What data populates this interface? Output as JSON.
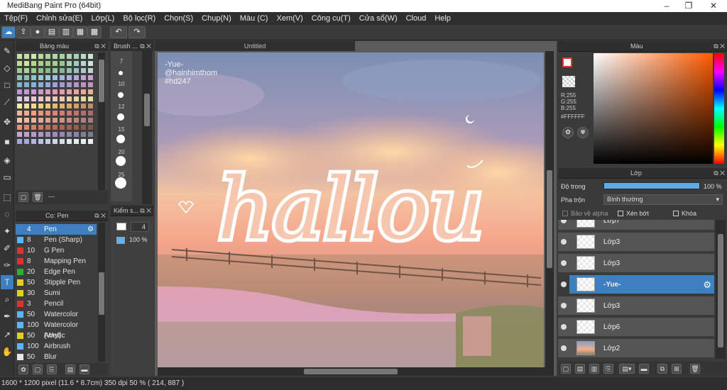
{
  "window": {
    "title": "MediBang Paint Pro (64bit)",
    "min": "–",
    "max": "❐",
    "close": "✕"
  },
  "menu": [
    "Tệp(F)",
    "Chỉnh sửa(E)",
    "Lớp(L)",
    "Bộ lọc(R)",
    "Chọn(S)",
    "Chụp(N)",
    "Màu (C)",
    "Xem(V)",
    "Công cụ(T)",
    "Cửa sổ(W)",
    "Cloud",
    "Help"
  ],
  "panels": {
    "palette_title": "Bảng màu",
    "brush_size_title": "Brush ...",
    "brush_title": "Cọ: Pen",
    "kiem_title": "Kiểm s...",
    "color_title": "Màu",
    "layer_title": "Lớp",
    "palette_footer": "---"
  },
  "brush_sizes": [
    "7",
    "10",
    "12",
    "15",
    "20",
    "25"
  ],
  "brushes": [
    {
      "size": "4",
      "name": "Pen",
      "color": "#3d7fc1"
    },
    {
      "size": "8",
      "name": "Pen (Sharp)",
      "color": "#5ab4ff"
    },
    {
      "size": "10",
      "name": "G Pen",
      "color": "#e03030"
    },
    {
      "size": "8",
      "name": "Mapping Pen",
      "color": "#e03030"
    },
    {
      "size": "20",
      "name": "Edge Pen",
      "color": "#30b030"
    },
    {
      "size": "50",
      "name": "Stipple Pen",
      "color": "#e0d020"
    },
    {
      "size": "30",
      "name": "Sumi",
      "color": "#e0d020"
    },
    {
      "size": "3",
      "name": "Pencil",
      "color": "#e03030"
    },
    {
      "size": "50",
      "name": "Watercolor",
      "color": "#5ab4ff"
    },
    {
      "size": "100",
      "name": "Watercolor (Wet)",
      "color": "#5ab4ff"
    },
    {
      "size": "50",
      "name": "Acrylic",
      "color": "#e0d020"
    },
    {
      "size": "100",
      "name": "Airbrush",
      "color": "#5ab4ff"
    },
    {
      "size": "50",
      "name": "Blur",
      "color": "#e8e8e8"
    }
  ],
  "kiem": {
    "size": "4",
    "opacity": "100 %"
  },
  "canvas": {
    "tab": "Untitled",
    "text_main": "hallou",
    "credit": [
      "-Yue-",
      "@hainhimthom",
      "#hd247"
    ]
  },
  "color": {
    "r": "R:255",
    "g": "G:255",
    "b": "B:255",
    "hex": "#FFFFFF"
  },
  "layer_opts": {
    "opacity_label": "Độ trong",
    "opacity_value": "100 %",
    "blend_label": "Pha trộn",
    "blend_value": "Bình thường",
    "protect_alpha": "Bảo vệ alpha",
    "clip": "Xén bớt",
    "lock": "Khóa"
  },
  "layers": [
    {
      "name": "Lớp7",
      "selected": false
    },
    {
      "name": "Lớp3",
      "selected": false
    },
    {
      "name": "Lớp3",
      "selected": false
    },
    {
      "name": "-Yue-",
      "selected": true
    },
    {
      "name": "Lớp3",
      "selected": false
    },
    {
      "name": "Lớp6",
      "selected": false
    },
    {
      "name": "Lớp2",
      "selected": false
    }
  ],
  "status": "1600 * 1200 pixel   (11.6 * 8.7cm)   350 dpi   50 %   ( 214, 887 )"
}
